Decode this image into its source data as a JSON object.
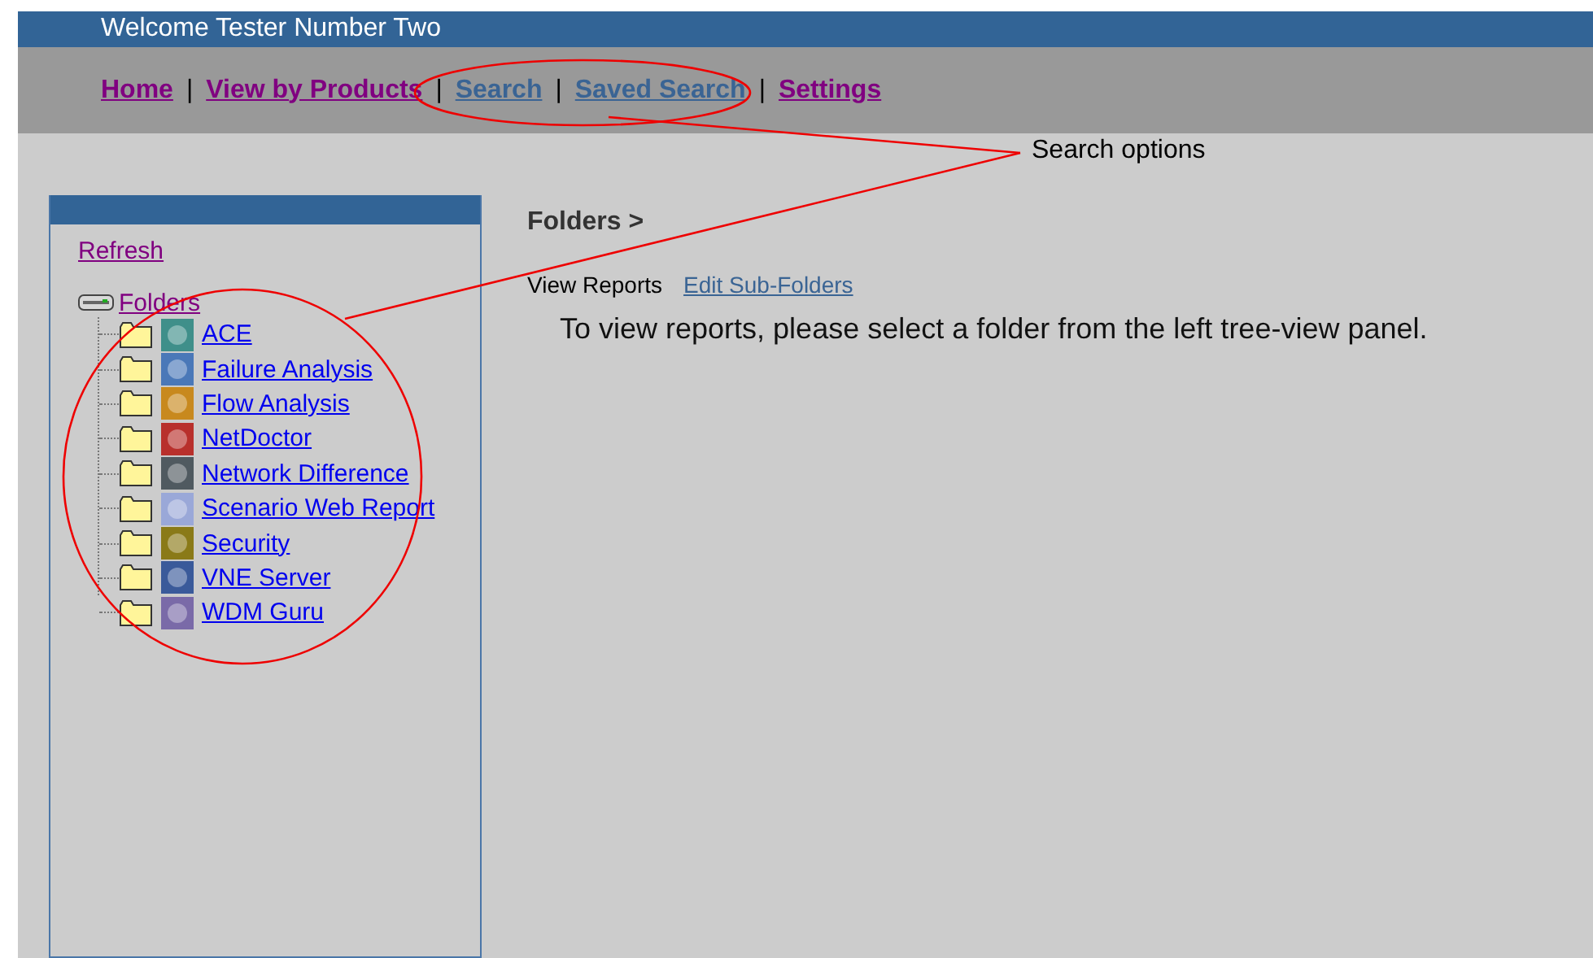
{
  "header": {
    "title": "Welcome Tester Number Two"
  },
  "nav": [
    {
      "label": "Home",
      "visited": true
    },
    {
      "separator": "|",
      "label": "View by Products",
      "visited": true
    },
    {
      "separator": "|",
      "label": "Search",
      "visited": false
    },
    {
      "separator": "|",
      "label": "Saved Search",
      "visited": false
    },
    {
      "separator": "|",
      "label": "Settings",
      "visited": true
    }
  ],
  "sidebar": {
    "refresh": {
      "label": "Refresh",
      "visited": true
    },
    "tree": {
      "label": "Folders",
      "visited": true,
      "expanded": true,
      "children": [
        {
          "label": "ACE",
          "visited": false,
          "color": "#3f8f8a"
        },
        {
          "label": "Failure Analysis",
          "visited": false,
          "color": "#4a78b8"
        },
        {
          "label": "Flow Analysis",
          "visited": false,
          "color": "#c8891e"
        },
        {
          "label": "NetDoctor",
          "visited": false,
          "color": "#b8302c"
        },
        {
          "label": "Network Difference",
          "visited": false,
          "color": "#505a60"
        },
        {
          "label": "Scenario Web Report",
          "visited": false,
          "color": "#9aa8d8"
        },
        {
          "label": "Security",
          "visited": false,
          "color": "#8a7a18"
        },
        {
          "label": "VNE Server",
          "visited": false,
          "color": "#3a5a9a"
        },
        {
          "label": "WDM Guru",
          "visited": false,
          "color": "#7a6aa8"
        }
      ]
    }
  },
  "content": {
    "breadcrumb": "Folders >",
    "actions": [
      {
        "label": "View Reports",
        "kind": "text"
      },
      {
        "label": "Edit Sub-Folders",
        "kind": "link"
      }
    ],
    "message": "To view reports, please select a folder from the left tree-view panel."
  },
  "annotation": {
    "label": "Search options"
  }
}
